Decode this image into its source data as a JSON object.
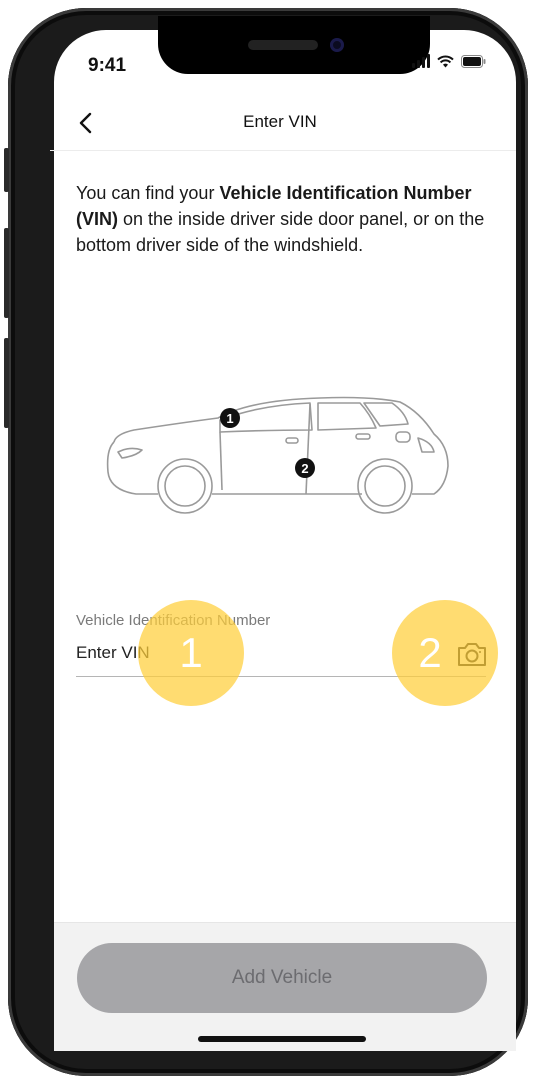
{
  "status_bar": {
    "time": "9:41"
  },
  "nav": {
    "title": "Enter VIN"
  },
  "intro": {
    "part1": "You can find your ",
    "bold": "Vehicle Identification Number (VIN)",
    "part2": " on the inside driver side door panel, or on the bottom driver side of the windshield."
  },
  "car_markers": {
    "marker1": "1",
    "marker2": "2"
  },
  "vin_field": {
    "label": "Vehicle Identification Number",
    "placeholder": "Enter VIN"
  },
  "hints": {
    "hint1": "1",
    "hint2": "2"
  },
  "actions": {
    "add_vehicle_label": "Add Vehicle"
  },
  "colors": {
    "hint_highlight": "#ffce3a",
    "button_disabled": "#a6a6a9"
  }
}
